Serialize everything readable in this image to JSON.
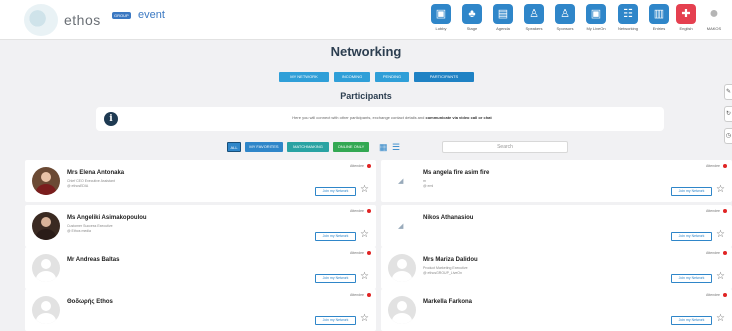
{
  "brand": {
    "logo_text": "ethos",
    "logo_group": "GROUP",
    "logo_event": "event"
  },
  "nav": [
    {
      "label": "Lobby",
      "icon": "lobby-icon",
      "glyph": "▣"
    },
    {
      "label": "Stage",
      "icon": "stage-icon",
      "glyph": "♣"
    },
    {
      "label": "Agenda",
      "icon": "agenda-icon",
      "glyph": "▤"
    },
    {
      "label": "Speakers",
      "icon": "speakers-icon",
      "glyph": "♙"
    },
    {
      "label": "Sponsors",
      "icon": "sponsors-icon",
      "glyph": "♙"
    },
    {
      "label": "My LiveOn",
      "icon": "myliveon-icon",
      "glyph": "▣"
    },
    {
      "label": "Networking",
      "icon": "networking-icon",
      "glyph": "☷"
    },
    {
      "label": "Entries",
      "icon": "entries-icon",
      "glyph": "▥"
    },
    {
      "label": "English",
      "icon": "uk-flag-icon",
      "glyph": "✚"
    },
    {
      "label": "MAKOS",
      "icon": "user-profile-icon",
      "glyph": "●"
    }
  ],
  "page_title": "Networking",
  "tabs": [
    {
      "label": "MY NETWORK",
      "active": false
    },
    {
      "label": "INCOMING",
      "active": false
    },
    {
      "label": "PENDING",
      "active": false
    },
    {
      "label": "PARTICIPANTS",
      "active": true
    }
  ],
  "subtitle": "Participants",
  "info": {
    "text": "Here you will connect with other participants, exchange contact details and ",
    "bold": "communicate via video call or chat"
  },
  "filters": [
    {
      "label": "ALL",
      "active": true
    },
    {
      "label": "MY FAVORITES",
      "active": false
    },
    {
      "label": "MATCHMAKING",
      "active": false
    },
    {
      "label": "ONLINE ONLY",
      "active": false
    }
  ],
  "view_icons": {
    "grid": "grid-view-icon",
    "list": "list-view-icon"
  },
  "search": {
    "placeholder": "Search"
  },
  "participants": [
    {
      "name": "Mrs Elena Antonaka",
      "role": "Chief CEO Executive Assistant",
      "company": "@ ethosEDIA",
      "status": "Attendee",
      "join": "Join my Network",
      "avatar": "photo"
    },
    {
      "name": "Ms angela fire asim fire",
      "role": "m",
      "company": "@ eml",
      "status": "Attendee",
      "join": "Join my Network",
      "avatar": "blank"
    },
    {
      "name": "Ms Angeliki Asimakopoulou",
      "role": "Customer Success Executive",
      "company": "@ Ethos media",
      "status": "Attendee",
      "join": "Join my Network",
      "avatar": "photo2"
    },
    {
      "name": "Nikos Athanasiou",
      "role": "",
      "company": "",
      "status": "Attendee",
      "join": "Join my Network",
      "avatar": "blank"
    },
    {
      "name": "Mr Andreas Baltas",
      "role": "",
      "company": "",
      "status": "Attendee",
      "join": "Join my Network",
      "avatar": "default"
    },
    {
      "name": "Mrs Mariza Dalidou",
      "role": "Product Marketing Executive",
      "company": "@ ethosGROUP_LiveOn",
      "status": "Attendee",
      "join": "Join my Network",
      "avatar": "default"
    },
    {
      "name": "Θοδωρής Ethos",
      "role": "",
      "company": "",
      "status": "Attendee",
      "join": "Join my Network",
      "avatar": "default"
    },
    {
      "name": "Markella Farkona",
      "role": "",
      "company": "",
      "status": "Attendee",
      "join": "Join my Network",
      "avatar": "default"
    }
  ],
  "side_tools": [
    {
      "icon": "edit-icon",
      "glyph": "✎"
    },
    {
      "icon": "refresh-icon",
      "glyph": "↻"
    },
    {
      "icon": "clock-icon",
      "glyph": "◷"
    }
  ],
  "colors": {
    "primary": "#2f86c9",
    "online_dot": "#e02424",
    "matchmaking": "#2aa3a3",
    "online_only": "#33a853"
  }
}
